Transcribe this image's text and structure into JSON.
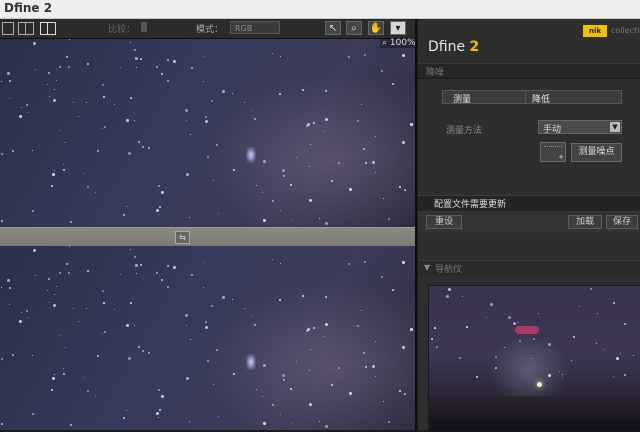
{
  "window": {
    "title": "Dfine 2"
  },
  "toolbar": {
    "label_compare": "比较：",
    "label_mode": "模式：",
    "mode_value": "RGB",
    "zoom_level": "100%"
  },
  "panel": {
    "app_name": "Dfine",
    "app_version": "2",
    "brand_badge": "nik",
    "brand_text": "collection",
    "section_reduce": "降噪",
    "tab_measure": "测量",
    "tab_reduce": "降低",
    "measure_method_label": "测量方法",
    "measure_method_value": "手动",
    "measure_noise_button": "测量噪点",
    "profile_updated": "配置文件需要更新",
    "reset_button": "重设",
    "load_button": "加载",
    "save_button": "保存",
    "navigator_title": "导航仪"
  },
  "colors": {
    "accent": "#f2c200",
    "panel_bg": "#2e2e2e",
    "toolbar_bg": "#2b2b2b",
    "sky": "#363a5c"
  }
}
